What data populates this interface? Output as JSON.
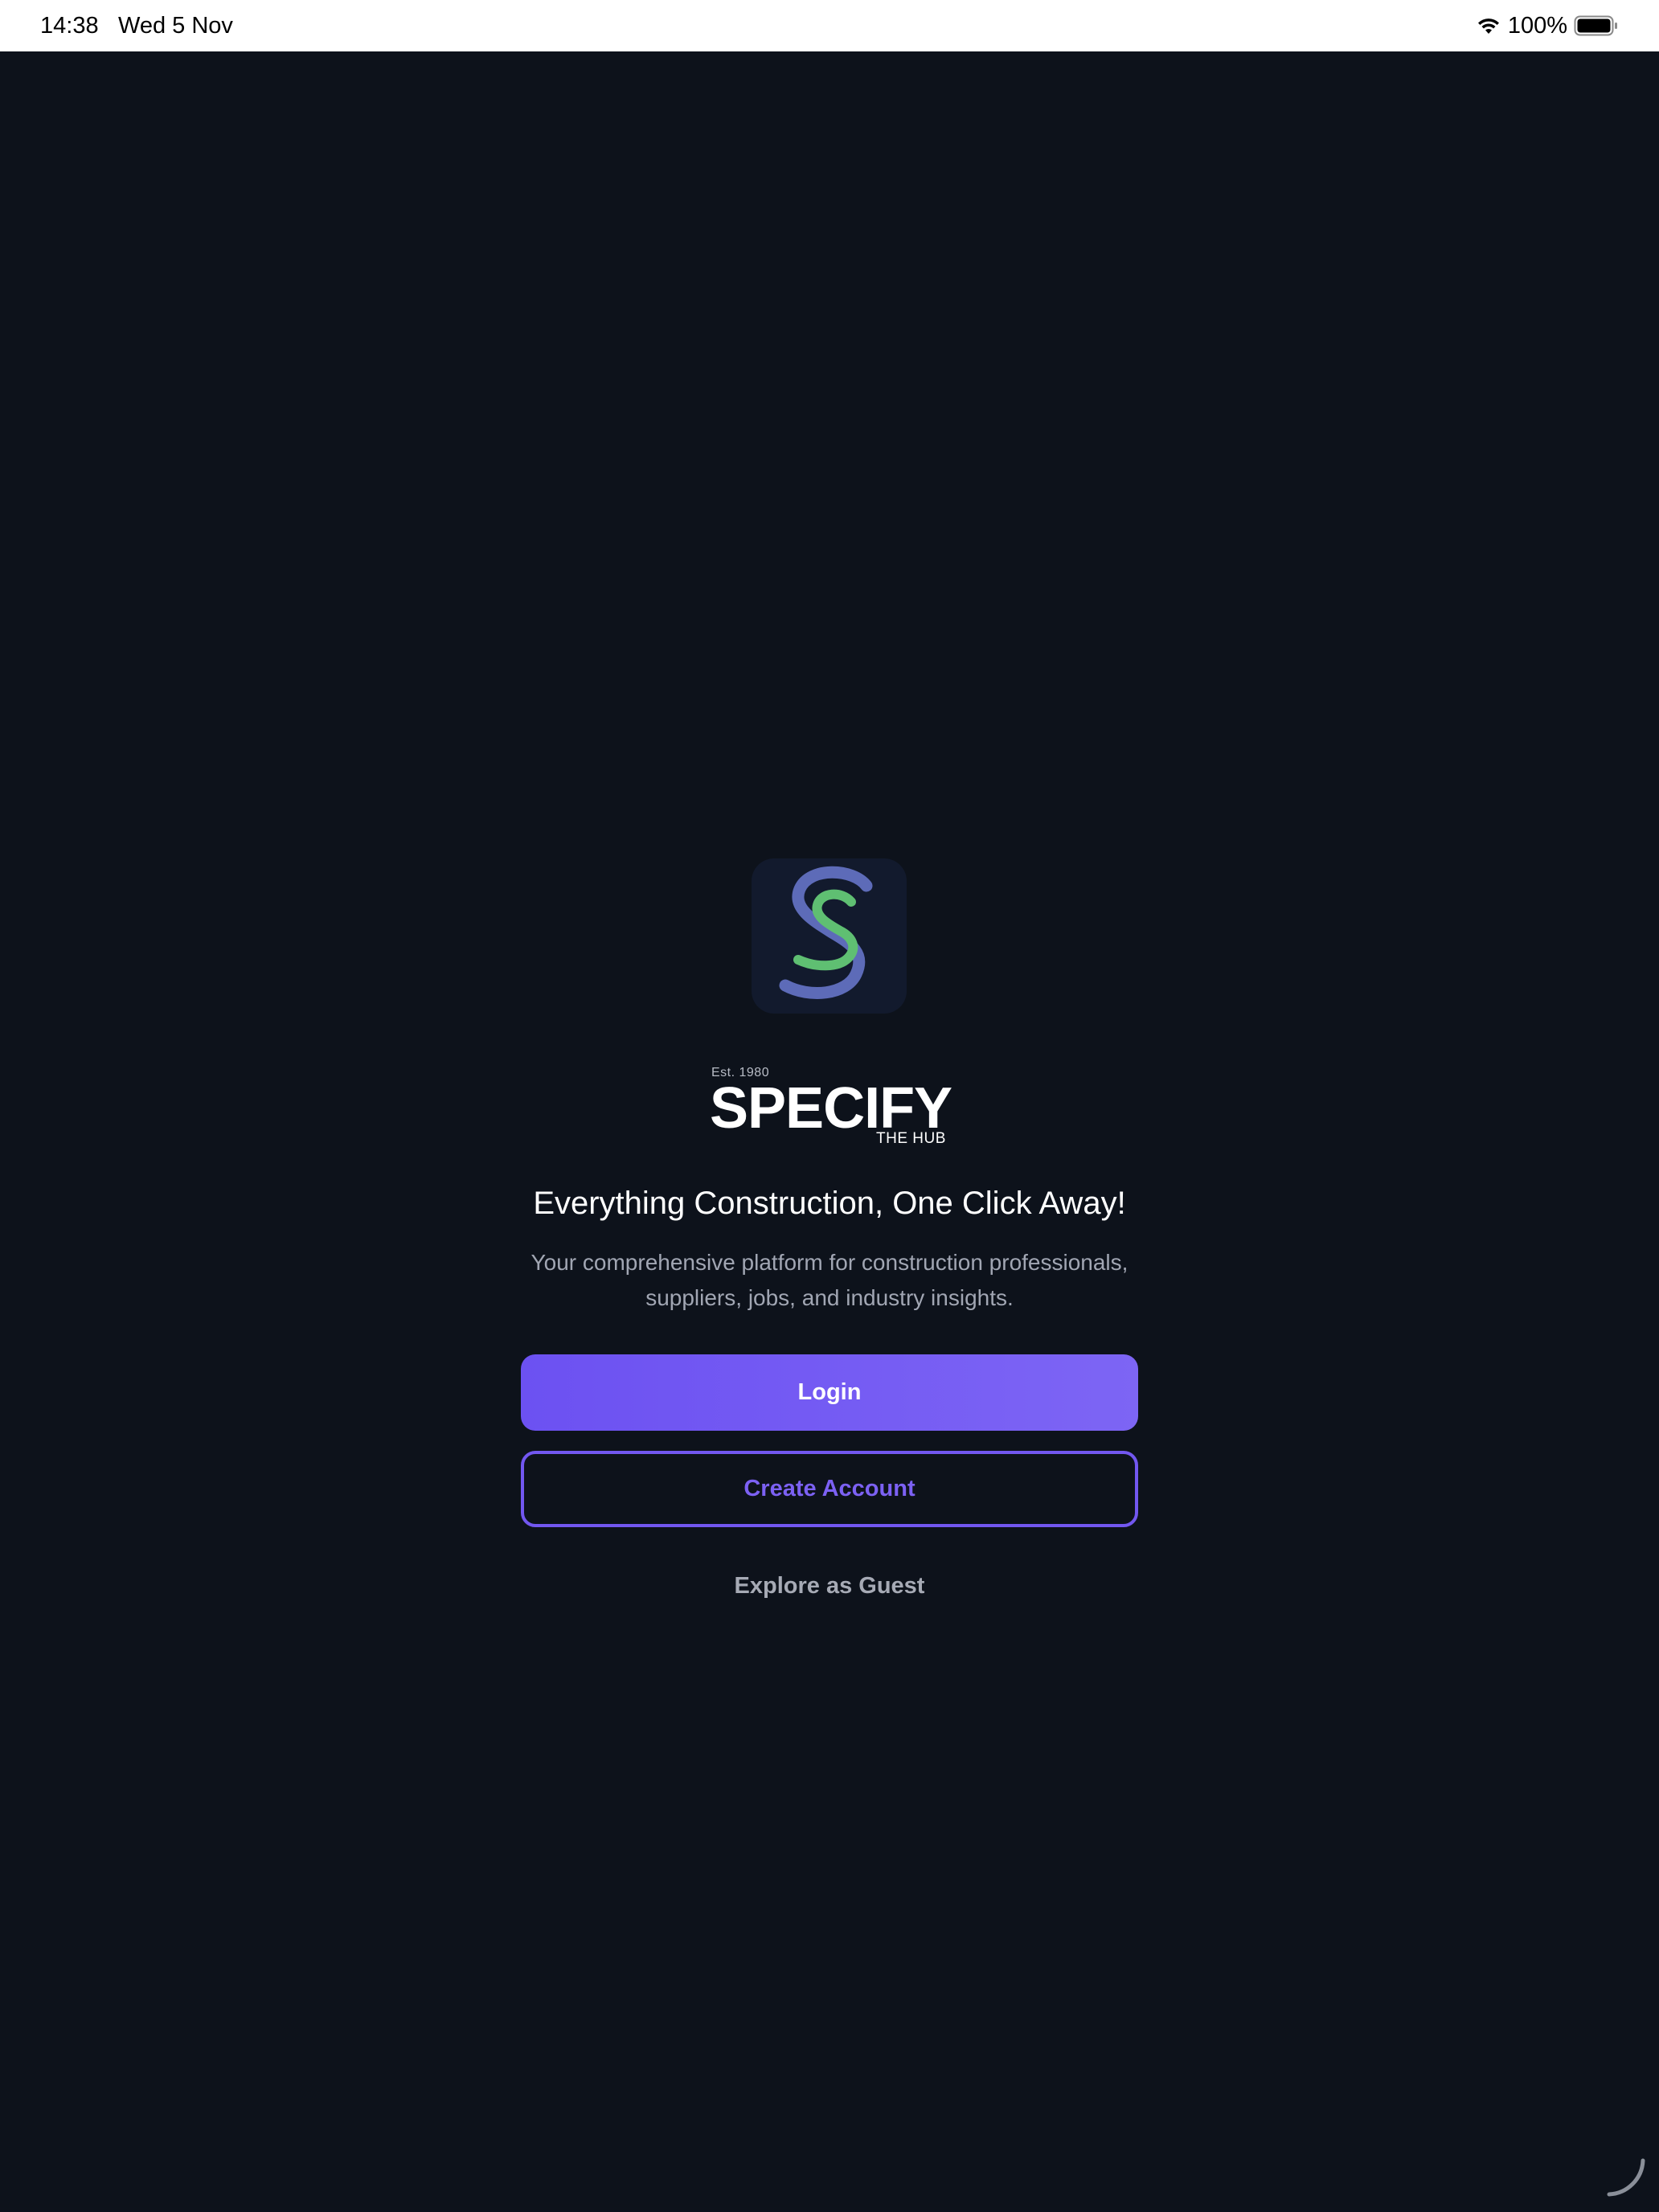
{
  "status_bar": {
    "time": "14:38",
    "date": "Wed 5 Nov",
    "battery_percent": "100%",
    "icons": [
      "wifi-icon",
      "battery-icon"
    ]
  },
  "brand": {
    "logo_icon": "specify-s-logo",
    "established": "Est. 1980",
    "name": "SPECIFY",
    "tagline": "THE HUB"
  },
  "hero": {
    "headline": "Everything Construction, One Click Away!",
    "description": "Your comprehensive platform for construction professionals, suppliers, jobs, and industry insights."
  },
  "actions": {
    "login_label": "Login",
    "create_account_label": "Create Account",
    "guest_label": "Explore as Guest"
  },
  "colors": {
    "background": "#0d121b",
    "accent": "#6c51f2",
    "logo_blue": "#5d6bb8",
    "logo_green": "#5fbf72"
  }
}
